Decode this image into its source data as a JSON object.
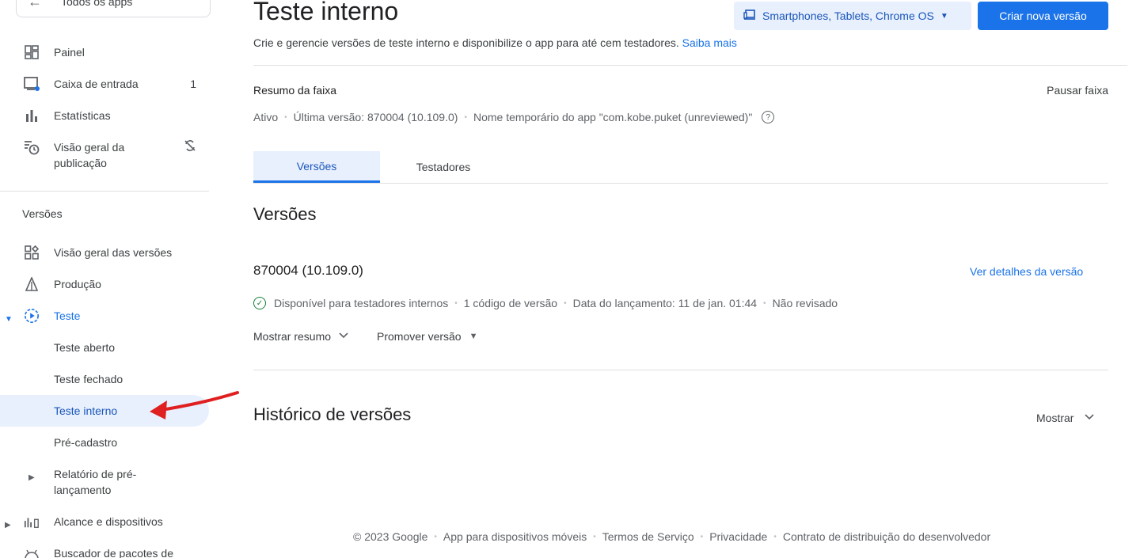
{
  "sidebar": {
    "all_apps": "Todos os apps",
    "items_top": [
      {
        "label": "Painel",
        "icon": "dashboard-icon"
      },
      {
        "label": "Caixa de entrada",
        "count": "1",
        "icon": "inbox-icon"
      },
      {
        "label": "Estatísticas",
        "icon": "bar-chart-icon"
      },
      {
        "label": "Visão geral da",
        "label2": "publicação",
        "icon": "publishing-overview-icon"
      }
    ],
    "section_title": "Versões",
    "items_versions": [
      {
        "label": "Visão geral das versões",
        "icon": "grid-icon"
      },
      {
        "label": "Produção",
        "icon": "production-icon"
      },
      {
        "label": "Teste",
        "icon": "play-circle-icon"
      }
    ],
    "test_sub": [
      {
        "label": "Teste aberto"
      },
      {
        "label": "Teste fechado"
      },
      {
        "label": "Teste interno"
      },
      {
        "label": "Pré-cadastro"
      }
    ],
    "prelaunch": {
      "label": "Relatório de pré-",
      "label2": "lançamento"
    },
    "reach": {
      "label": "Alcance e dispositivos"
    },
    "bundle": {
      "label": "Buscador de pacotes de"
    }
  },
  "header": {
    "title": "Teste interno",
    "device_selector": "Smartphones, Tablets, Chrome OS",
    "create_button": "Criar nova versão",
    "subtitle": "Crie e gerencie versões de teste interno e disponibilize o app para até cem testadores.",
    "learn_more": "Saiba mais"
  },
  "track": {
    "summary_title": "Resumo da faixa",
    "pause": "Pausar faixa",
    "status": "Ativo",
    "latest": "Última versão: 870004 (10.109.0)",
    "temp_name": "Nome temporário do app \"com.kobe.puket (unreviewed)\""
  },
  "tabs": [
    {
      "label": "Versões",
      "active": true
    },
    {
      "label": "Testadores",
      "active": false
    }
  ],
  "releases": {
    "heading": "Versões",
    "code": "870004 (10.109.0)",
    "details_link": "Ver detalhes da versão",
    "available": "Disponível para testadores internos",
    "version_codes": "1 código de versão",
    "launch_date": "Data do lançamento: 11 de jan. 01:44",
    "review": "Não revisado",
    "show_summary": "Mostrar resumo",
    "promote": "Promover versão"
  },
  "history": {
    "heading": "Histórico de versões",
    "show": "Mostrar"
  },
  "footer": {
    "copyright": "© 2023 Google",
    "mobile_app": "App para dispositivos móveis",
    "terms": "Termos de Serviço",
    "privacy": "Privacidade",
    "distribution": "Contrato de distribuição do desenvolvedor"
  },
  "colors": {
    "accent": "#1a73e8",
    "active_bg": "#e8f0fe",
    "arrow": "#e02020",
    "success": "#188038"
  }
}
